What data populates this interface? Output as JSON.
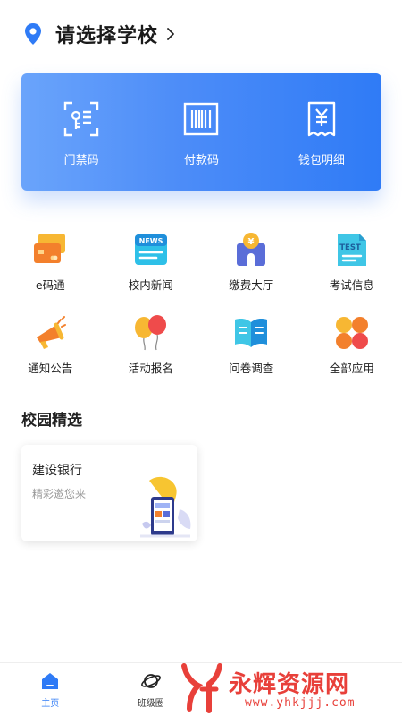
{
  "header": {
    "school_label": "请选择学校"
  },
  "card": {
    "items": [
      {
        "label": "门禁码",
        "icon": "door-qr-icon"
      },
      {
        "label": "付款码",
        "icon": "barcode-icon"
      },
      {
        "label": "钱包明细",
        "icon": "receipt-yuan-icon"
      }
    ]
  },
  "grid": {
    "items": [
      {
        "label": "e码通",
        "icon": "cards-icon"
      },
      {
        "label": "校内新闻",
        "icon": "news-icon",
        "badge": "NEWS"
      },
      {
        "label": "缴费大厅",
        "icon": "payment-hall-icon",
        "badge": "¥"
      },
      {
        "label": "考试信息",
        "icon": "test-doc-icon",
        "badge": "TEST"
      },
      {
        "label": "通知公告",
        "icon": "megaphone-icon"
      },
      {
        "label": "活动报名",
        "icon": "balloons-icon"
      },
      {
        "label": "问卷调查",
        "icon": "book-icon"
      },
      {
        "label": "全部应用",
        "icon": "apps-icon"
      }
    ]
  },
  "selection": {
    "title": "校园精选",
    "promo": {
      "title": "建设银行",
      "subtitle": "精彩邀您来"
    }
  },
  "tabbar": {
    "items": [
      {
        "label": "主页",
        "icon": "home-icon",
        "active": true
      },
      {
        "label": "班级圈",
        "icon": "planet-icon",
        "active": false
      }
    ]
  },
  "watermark": {
    "brand": "永辉资源网",
    "url": "www.yhkjjj.com"
  },
  "colors": {
    "accent": "#2f7bf6",
    "card_start": "#6aa4fb",
    "card_end": "#2f7bf6",
    "watermark": "#e8403a"
  }
}
